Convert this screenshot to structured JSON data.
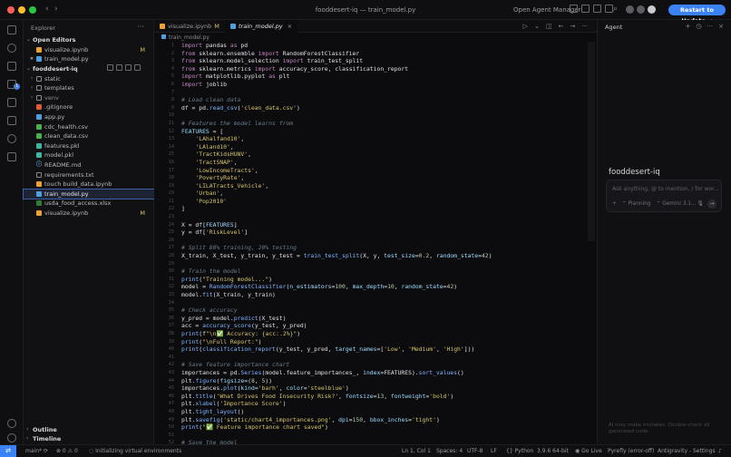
{
  "window": {
    "title": "fooddesert-iq — train_model.py",
    "agent_manager": "Open Agent Manager",
    "restart_button": "Restart to Update →"
  },
  "activity_badge": "1",
  "explorer": {
    "header": "Explorer",
    "open_editors_label": "Open Editors",
    "open_editors": [
      {
        "name": "visualize.ipynb",
        "status": "M",
        "icon_color": "#e9a23b"
      },
      {
        "name": "train_model.py",
        "status": "",
        "icon_color": "#4f9fe0"
      }
    ],
    "project_label": "fooddesert-iq",
    "items": [
      {
        "name": "static",
        "kind": "folder",
        "status": ""
      },
      {
        "name": "templates",
        "kind": "folder",
        "status": ""
      },
      {
        "name": "venv",
        "kind": "folder",
        "status": ""
      },
      {
        "name": ".gitignore",
        "kind": "git",
        "status": ""
      },
      {
        "name": "app.py",
        "kind": "py",
        "status": ""
      },
      {
        "name": "cdc_health.csv",
        "kind": "csv",
        "status": ""
      },
      {
        "name": "clean_data.csv",
        "kind": "csv",
        "status": ""
      },
      {
        "name": "features.pkl",
        "kind": "pkl",
        "status": ""
      },
      {
        "name": "model.pkl",
        "kind": "pkl",
        "status": ""
      },
      {
        "name": "README.md",
        "kind": "md",
        "status": ""
      },
      {
        "name": "requirements.txt",
        "kind": "txt",
        "status": ""
      },
      {
        "name": "touch build_data.ipynb",
        "kind": "nb",
        "status": ""
      },
      {
        "name": "train_model.py",
        "kind": "py",
        "status": ""
      },
      {
        "name": "usda_food_access.xlsx",
        "kind": "xlsx",
        "status": ""
      },
      {
        "name": "visualize.ipynb",
        "kind": "nb",
        "status": "M"
      }
    ],
    "outline": "Outline",
    "timeline": "Timeline"
  },
  "tabs": [
    {
      "name": "visualize.ipynb",
      "marker": "M"
    },
    {
      "name": "train_model.py",
      "marker": ""
    }
  ],
  "breadcrumb": "train_model.py",
  "agent": {
    "header": "Agent",
    "project": "fooddesert-iq",
    "placeholder": "Ask anything, @ to mention, / for wor...",
    "opt_plus": "+",
    "opt_planning": "Planning",
    "opt_model": "Gemini 3.1...",
    "footer": "AI may make mistakes. Double-check all generated code."
  },
  "status": {
    "branch": "main*",
    "problems": "⊗ 0  ⚠ 0",
    "task": "Initializing virtual environments",
    "position": "Ln 1, Col 1",
    "spaces": "Spaces: 4",
    "encoding": "UTF-8",
    "eol": "LF",
    "language": "{} Python",
    "interpreter": "3.9.6 64-bit",
    "golive": "Go Live",
    "pyrefly": "Pyrefly (error-off)",
    "settings": "Antigravity - Settings"
  },
  "code_lines": [
    [
      [
        "k",
        "import"
      ],
      [
        "p",
        " pandas "
      ],
      [
        "k",
        "as"
      ],
      [
        "p",
        " pd"
      ]
    ],
    [
      [
        "k",
        "from"
      ],
      [
        "p",
        " sklearn.ensemble "
      ],
      [
        "k",
        "import"
      ],
      [
        "p",
        " RandomForestClassifier"
      ]
    ],
    [
      [
        "k",
        "from"
      ],
      [
        "p",
        " sklearn.model_selection "
      ],
      [
        "k",
        "import"
      ],
      [
        "p",
        " train_test_split"
      ]
    ],
    [
      [
        "k",
        "from"
      ],
      [
        "p",
        " sklearn.metrics "
      ],
      [
        "k",
        "import"
      ],
      [
        "p",
        " accuracy_score, classification_report"
      ]
    ],
    [
      [
        "k",
        "import"
      ],
      [
        "p",
        " matplotlib.pyplot "
      ],
      [
        "k",
        "as"
      ],
      [
        "p",
        " plt"
      ]
    ],
    [
      [
        "k",
        "import"
      ],
      [
        "p",
        " joblib"
      ]
    ],
    [],
    [
      [
        "c",
        "# Load clean data"
      ]
    ],
    [
      [
        "p",
        "df = pd."
      ],
      [
        "f",
        "read_csv"
      ],
      [
        "p",
        "("
      ],
      [
        "s",
        "'clean_data.csv'"
      ],
      [
        "p",
        ")"
      ]
    ],
    [],
    [
      [
        "c",
        "# Features the model learns from"
      ]
    ],
    [
      [
        "v",
        "FEATURES"
      ],
      [
        "p",
        " = ["
      ]
    ],
    [
      [
        "p",
        "    "
      ],
      [
        "s",
        "'LAhalfand10'"
      ],
      [
        "p",
        ","
      ]
    ],
    [
      [
        "p",
        "    "
      ],
      [
        "s",
        "'LAland10'"
      ],
      [
        "p",
        ","
      ]
    ],
    [
      [
        "p",
        "    "
      ],
      [
        "s",
        "'TractKidsHUNV'"
      ],
      [
        "p",
        ","
      ]
    ],
    [
      [
        "p",
        "    "
      ],
      [
        "s",
        "'TractSNAP'"
      ],
      [
        "p",
        ","
      ]
    ],
    [
      [
        "p",
        "    "
      ],
      [
        "s",
        "'LowIncomeTracts'"
      ],
      [
        "p",
        ","
      ]
    ],
    [
      [
        "p",
        "    "
      ],
      [
        "s",
        "'PovertyRate'"
      ],
      [
        "p",
        ","
      ]
    ],
    [
      [
        "p",
        "    "
      ],
      [
        "s",
        "'LILATracts_Vehicle'"
      ],
      [
        "p",
        ","
      ]
    ],
    [
      [
        "p",
        "    "
      ],
      [
        "s",
        "'Urban'"
      ],
      [
        "p",
        ","
      ]
    ],
    [
      [
        "p",
        "    "
      ],
      [
        "s",
        "'Pop2010'"
      ]
    ],
    [
      [
        "p",
        "]"
      ]
    ],
    [],
    [
      [
        "p",
        "X = df["
      ],
      [
        "v",
        "FEATURES"
      ],
      [
        "p",
        "]"
      ]
    ],
    [
      [
        "p",
        "y = df["
      ],
      [
        "s",
        "'RiskLevel'"
      ],
      [
        "p",
        "]"
      ]
    ],
    [],
    [
      [
        "c",
        "# Split 80% training, 20% testing"
      ]
    ],
    [
      [
        "p",
        "X_train, X_test, y_train, y_test = "
      ],
      [
        "f",
        "train_test_split"
      ],
      [
        "p",
        "(X, y, "
      ],
      [
        "v",
        "test_size"
      ],
      [
        "p",
        "="
      ],
      [
        "n",
        "0.2"
      ],
      [
        "p",
        ", "
      ],
      [
        "v",
        "random_state"
      ],
      [
        "p",
        "="
      ],
      [
        "n",
        "42"
      ],
      [
        "p",
        ")"
      ]
    ],
    [],
    [
      [
        "c",
        "# Train the model"
      ]
    ],
    [
      [
        "f",
        "print"
      ],
      [
        "p",
        "("
      ],
      [
        "s",
        "\"Training model...\""
      ],
      [
        "p",
        ")"
      ]
    ],
    [
      [
        "p",
        "model = "
      ],
      [
        "f",
        "RandomForestClassifier"
      ],
      [
        "p",
        "("
      ],
      [
        "v",
        "n_estimators"
      ],
      [
        "p",
        "="
      ],
      [
        "n",
        "100"
      ],
      [
        "p",
        ", "
      ],
      [
        "v",
        "max_depth"
      ],
      [
        "p",
        "="
      ],
      [
        "n",
        "10"
      ],
      [
        "p",
        ", "
      ],
      [
        "v",
        "random_state"
      ],
      [
        "p",
        "="
      ],
      [
        "n",
        "42"
      ],
      [
        "p",
        ")"
      ]
    ],
    [
      [
        "p",
        "model."
      ],
      [
        "f",
        "fit"
      ],
      [
        "p",
        "(X_train, y_train)"
      ]
    ],
    [],
    [
      [
        "c",
        "# Check accuracy"
      ]
    ],
    [
      [
        "p",
        "y_pred = model."
      ],
      [
        "f",
        "predict"
      ],
      [
        "p",
        "(X_test)"
      ]
    ],
    [
      [
        "p",
        "acc = "
      ],
      [
        "f",
        "accuracy_score"
      ],
      [
        "p",
        "(y_test, y_pred)"
      ]
    ],
    [
      [
        "f",
        "print"
      ],
      [
        "p",
        "(f"
      ],
      [
        "s",
        "\"\\n✅ Accuracy: {acc:.2%}\""
      ],
      [
        "p",
        ")"
      ]
    ],
    [
      [
        "f",
        "print"
      ],
      [
        "p",
        "("
      ],
      [
        "s",
        "\"\\nFull Report:\""
      ],
      [
        "p",
        ")"
      ]
    ],
    [
      [
        "f",
        "print"
      ],
      [
        "p",
        "("
      ],
      [
        "f",
        "classification_report"
      ],
      [
        "p",
        "(y_test, y_pred, "
      ],
      [
        "v",
        "target_names"
      ],
      [
        "p",
        "=["
      ],
      [
        "s",
        "'Low'"
      ],
      [
        "p",
        ", "
      ],
      [
        "s",
        "'Medium'"
      ],
      [
        "p",
        ", "
      ],
      [
        "s",
        "'High'"
      ],
      [
        "p",
        "]))"
      ]
    ],
    [],
    [
      [
        "c",
        "# Save feature importance chart"
      ]
    ],
    [
      [
        "p",
        "importances = pd."
      ],
      [
        "f",
        "Series"
      ],
      [
        "p",
        "(model.feature_importances_, "
      ],
      [
        "v",
        "index"
      ],
      [
        "p",
        "=FEATURES)."
      ],
      [
        "f",
        "sort_values"
      ],
      [
        "p",
        "()"
      ]
    ],
    [
      [
        "p",
        "plt."
      ],
      [
        "f",
        "figure"
      ],
      [
        "p",
        "("
      ],
      [
        "v",
        "figsize"
      ],
      [
        "p",
        "=("
      ],
      [
        "n",
        "8"
      ],
      [
        "p",
        ", "
      ],
      [
        "n",
        "5"
      ],
      [
        "p",
        "))"
      ]
    ],
    [
      [
        "p",
        "importances."
      ],
      [
        "f",
        "plot"
      ],
      [
        "p",
        "("
      ],
      [
        "v",
        "kind"
      ],
      [
        "p",
        "="
      ],
      [
        "s",
        "'barh'"
      ],
      [
        "p",
        ", "
      ],
      [
        "v",
        "color"
      ],
      [
        "p",
        "="
      ],
      [
        "s",
        "'steelblue'"
      ],
      [
        "p",
        ")"
      ]
    ],
    [
      [
        "p",
        "plt."
      ],
      [
        "f",
        "title"
      ],
      [
        "p",
        "("
      ],
      [
        "s",
        "'What Drives Food Insecurity Risk?'"
      ],
      [
        "p",
        ", "
      ],
      [
        "v",
        "fontsize"
      ],
      [
        "p",
        "="
      ],
      [
        "n",
        "13"
      ],
      [
        "p",
        ", "
      ],
      [
        "v",
        "fontweight"
      ],
      [
        "p",
        "="
      ],
      [
        "s",
        "'bold'"
      ],
      [
        "p",
        ")"
      ]
    ],
    [
      [
        "p",
        "plt."
      ],
      [
        "f",
        "xlabel"
      ],
      [
        "p",
        "("
      ],
      [
        "s",
        "'Importance Score'"
      ],
      [
        "p",
        ")"
      ]
    ],
    [
      [
        "p",
        "plt."
      ],
      [
        "f",
        "tight_layout"
      ],
      [
        "p",
        "()"
      ]
    ],
    [
      [
        "p",
        "plt."
      ],
      [
        "f",
        "savefig"
      ],
      [
        "p",
        "("
      ],
      [
        "s",
        "'static/chart4_importances.png'"
      ],
      [
        "p",
        ", "
      ],
      [
        "v",
        "dpi"
      ],
      [
        "p",
        "="
      ],
      [
        "n",
        "150"
      ],
      [
        "p",
        ", "
      ],
      [
        "v",
        "bbox_inches"
      ],
      [
        "p",
        "="
      ],
      [
        "s",
        "'tight'"
      ],
      [
        "p",
        ")"
      ]
    ],
    [
      [
        "f",
        "print"
      ],
      [
        "p",
        "("
      ],
      [
        "s",
        "\"✅ Feature importance chart saved\""
      ],
      [
        "p",
        ")"
      ]
    ],
    [],
    [
      [
        "c",
        "# Save the model"
      ]
    ]
  ]
}
